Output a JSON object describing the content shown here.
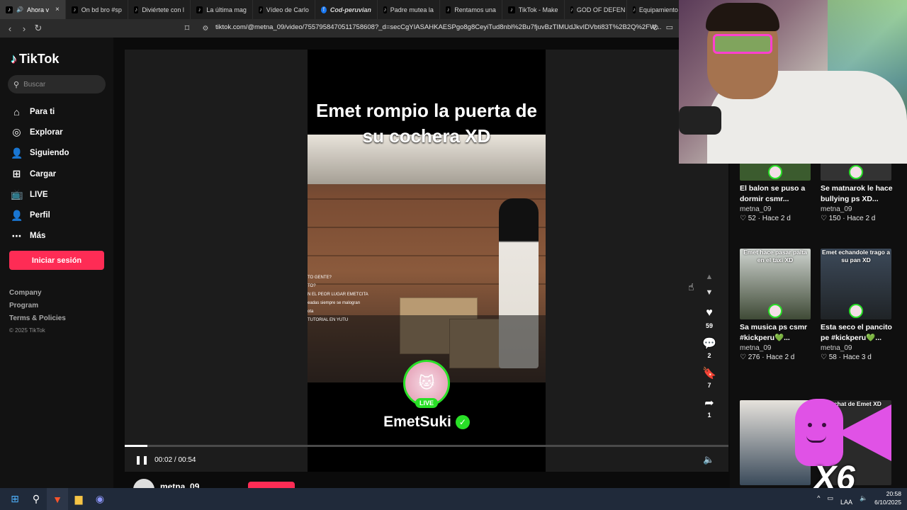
{
  "browser": {
    "tabs": [
      {
        "label": "Ahora v",
        "active": true,
        "icon": "tiktok-icon"
      },
      {
        "label": "On bd bro #sp",
        "icon": "tiktok-icon"
      },
      {
        "label": "Diviértete con l",
        "icon": "tiktok-icon"
      },
      {
        "label": "La última mag",
        "icon": "tiktok-icon"
      },
      {
        "label": "Vídeo de Carlo",
        "icon": "tiktok-icon"
      },
      {
        "label": "Cod-peruvian",
        "icon": "facebook-icon"
      },
      {
        "label": "Padre mutea la",
        "icon": "tiktok-icon"
      },
      {
        "label": "Rentamos una",
        "icon": "tiktok-icon"
      },
      {
        "label": "TikTok - Make",
        "icon": "tiktok-icon"
      },
      {
        "label": "GOD OF DEFEN",
        "icon": "tiktok-icon"
      },
      {
        "label": "Equipamiento",
        "icon": "tiktok-icon"
      }
    ],
    "url": "tiktok.com/@metna_09/video/7557958470511758608?_d=secCgYIASAHKAESPgo8g8CeyiTud8nbl%2Bu7fjuvBzTIMUdJkvIDVbti83T%2B2Q%2FW..."
  },
  "sidebar": {
    "brand": "TikTok",
    "search_placeholder": "Buscar",
    "nav": [
      {
        "label": "Para ti",
        "icon": "home-icon"
      },
      {
        "label": "Explorar",
        "icon": "compass-icon"
      },
      {
        "label": "Siguiendo",
        "icon": "following-icon"
      },
      {
        "label": "Cargar",
        "icon": "upload-icon"
      },
      {
        "label": "LIVE",
        "icon": "live-icon"
      },
      {
        "label": "Perfil",
        "icon": "profile-icon"
      },
      {
        "label": "Más",
        "icon": "more-icon"
      }
    ],
    "login_label": "Iniciar sesión",
    "footer": {
      "company": "Company",
      "program": "Program",
      "terms": "Terms & Policies",
      "copyright": "© 2025 TikTok"
    }
  },
  "video": {
    "title": "Emet rompio la puerta de su cochera XD",
    "chat_lines": [
      "TO GENTE?",
      "TO?",
      "N EL PEOR LUGAR EMETCITA",
      "eadas siempre se malogran",
      "ota",
      "TUTORIAL EN YUTU"
    ],
    "live_badge": "LIVE",
    "streamer": "EmetSuki",
    "time": "00:02 / 00:54",
    "progress": 0.037,
    "author": "metna_09"
  },
  "actions": {
    "likes": "59",
    "comments": "2",
    "saves": "7",
    "shares": "1"
  },
  "recommended": [
    {
      "caption": "",
      "title": "El balon se puso a dormir csmr...",
      "author": "metna_09",
      "likes": "52",
      "age": "Hace 2 d"
    },
    {
      "caption": "",
      "title": "Se matnarok le hace bullying ps XD...",
      "author": "metna_09",
      "likes": "150",
      "age": "Hace 2 d"
    },
    {
      "caption": "Emet hace pasar palta en el taxi XD",
      "title": "Sa musica ps csmr #kickperu💚...",
      "author": "metna_09",
      "likes": "276",
      "age": "Hace 2 d"
    },
    {
      "caption": "Emet echandole trago a su pan XD",
      "title": "Esta seco el pancito pe #kickperu💚...",
      "author": "metna_09",
      "likes": "58",
      "age": "Hace 3 d"
    },
    {
      "caption": "l chat de Emet XD",
      "title": "",
      "author": "",
      "likes": "",
      "age": ""
    }
  ],
  "overlay": {
    "multiplier": "X6"
  },
  "taskbar": {
    "lang": "LAA",
    "time": "20:58",
    "date": "6/10/2025"
  },
  "colors": {
    "accent": "#fe2c55",
    "live_green": "#29e027",
    "sticker_pink": "#e052e6"
  }
}
